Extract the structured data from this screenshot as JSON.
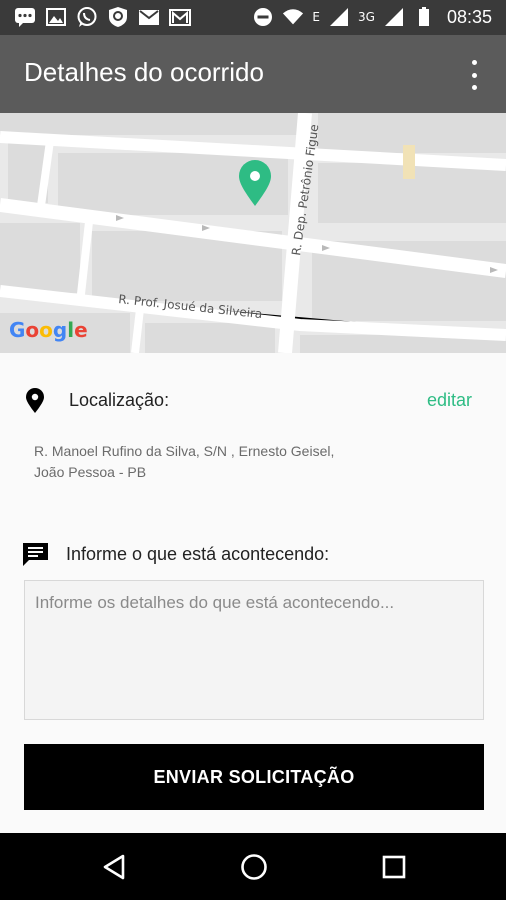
{
  "status_bar": {
    "time": "08:35",
    "network_label_1": "E",
    "network_label_2": "3G",
    "icons": [
      "chat-icon",
      "image-icon",
      "whatsapp-icon",
      "shield-icon",
      "mail-icon",
      "gmail-icon",
      "do-not-disturb-icon",
      "wifi-icon",
      "signal-icon",
      "signal-icon",
      "battery-icon"
    ]
  },
  "app_bar": {
    "title": "Detalhes do ocorrido",
    "menu_icon": "more-vert-icon"
  },
  "map": {
    "street_1": "R. Prof. Josué da Silveira",
    "street_2": "R. Dep. Petrônio Figue",
    "provider_logo": "Google",
    "pin_color": "#2ebc84"
  },
  "location": {
    "label": "Localização:",
    "edit_label": "editar",
    "address_line_1": "R. Manoel Rufino da Silva, S/N , Ernesto Geisel,",
    "address_line_2": "João Pessoa - PB"
  },
  "details": {
    "label": "Informe o que está acontecendo:",
    "placeholder": "Informe os detalhes do que está acontecendo...",
    "value": ""
  },
  "submit_label": "ENVIAR SOLICITAÇÃO",
  "nav": {
    "back": "back-icon",
    "home": "home-icon",
    "recents": "recents-icon"
  },
  "colors": {
    "accent": "#2ebc84",
    "app_bar": "#5b5b5b",
    "status_bar": "#3a3a3a",
    "button": "#000000"
  }
}
